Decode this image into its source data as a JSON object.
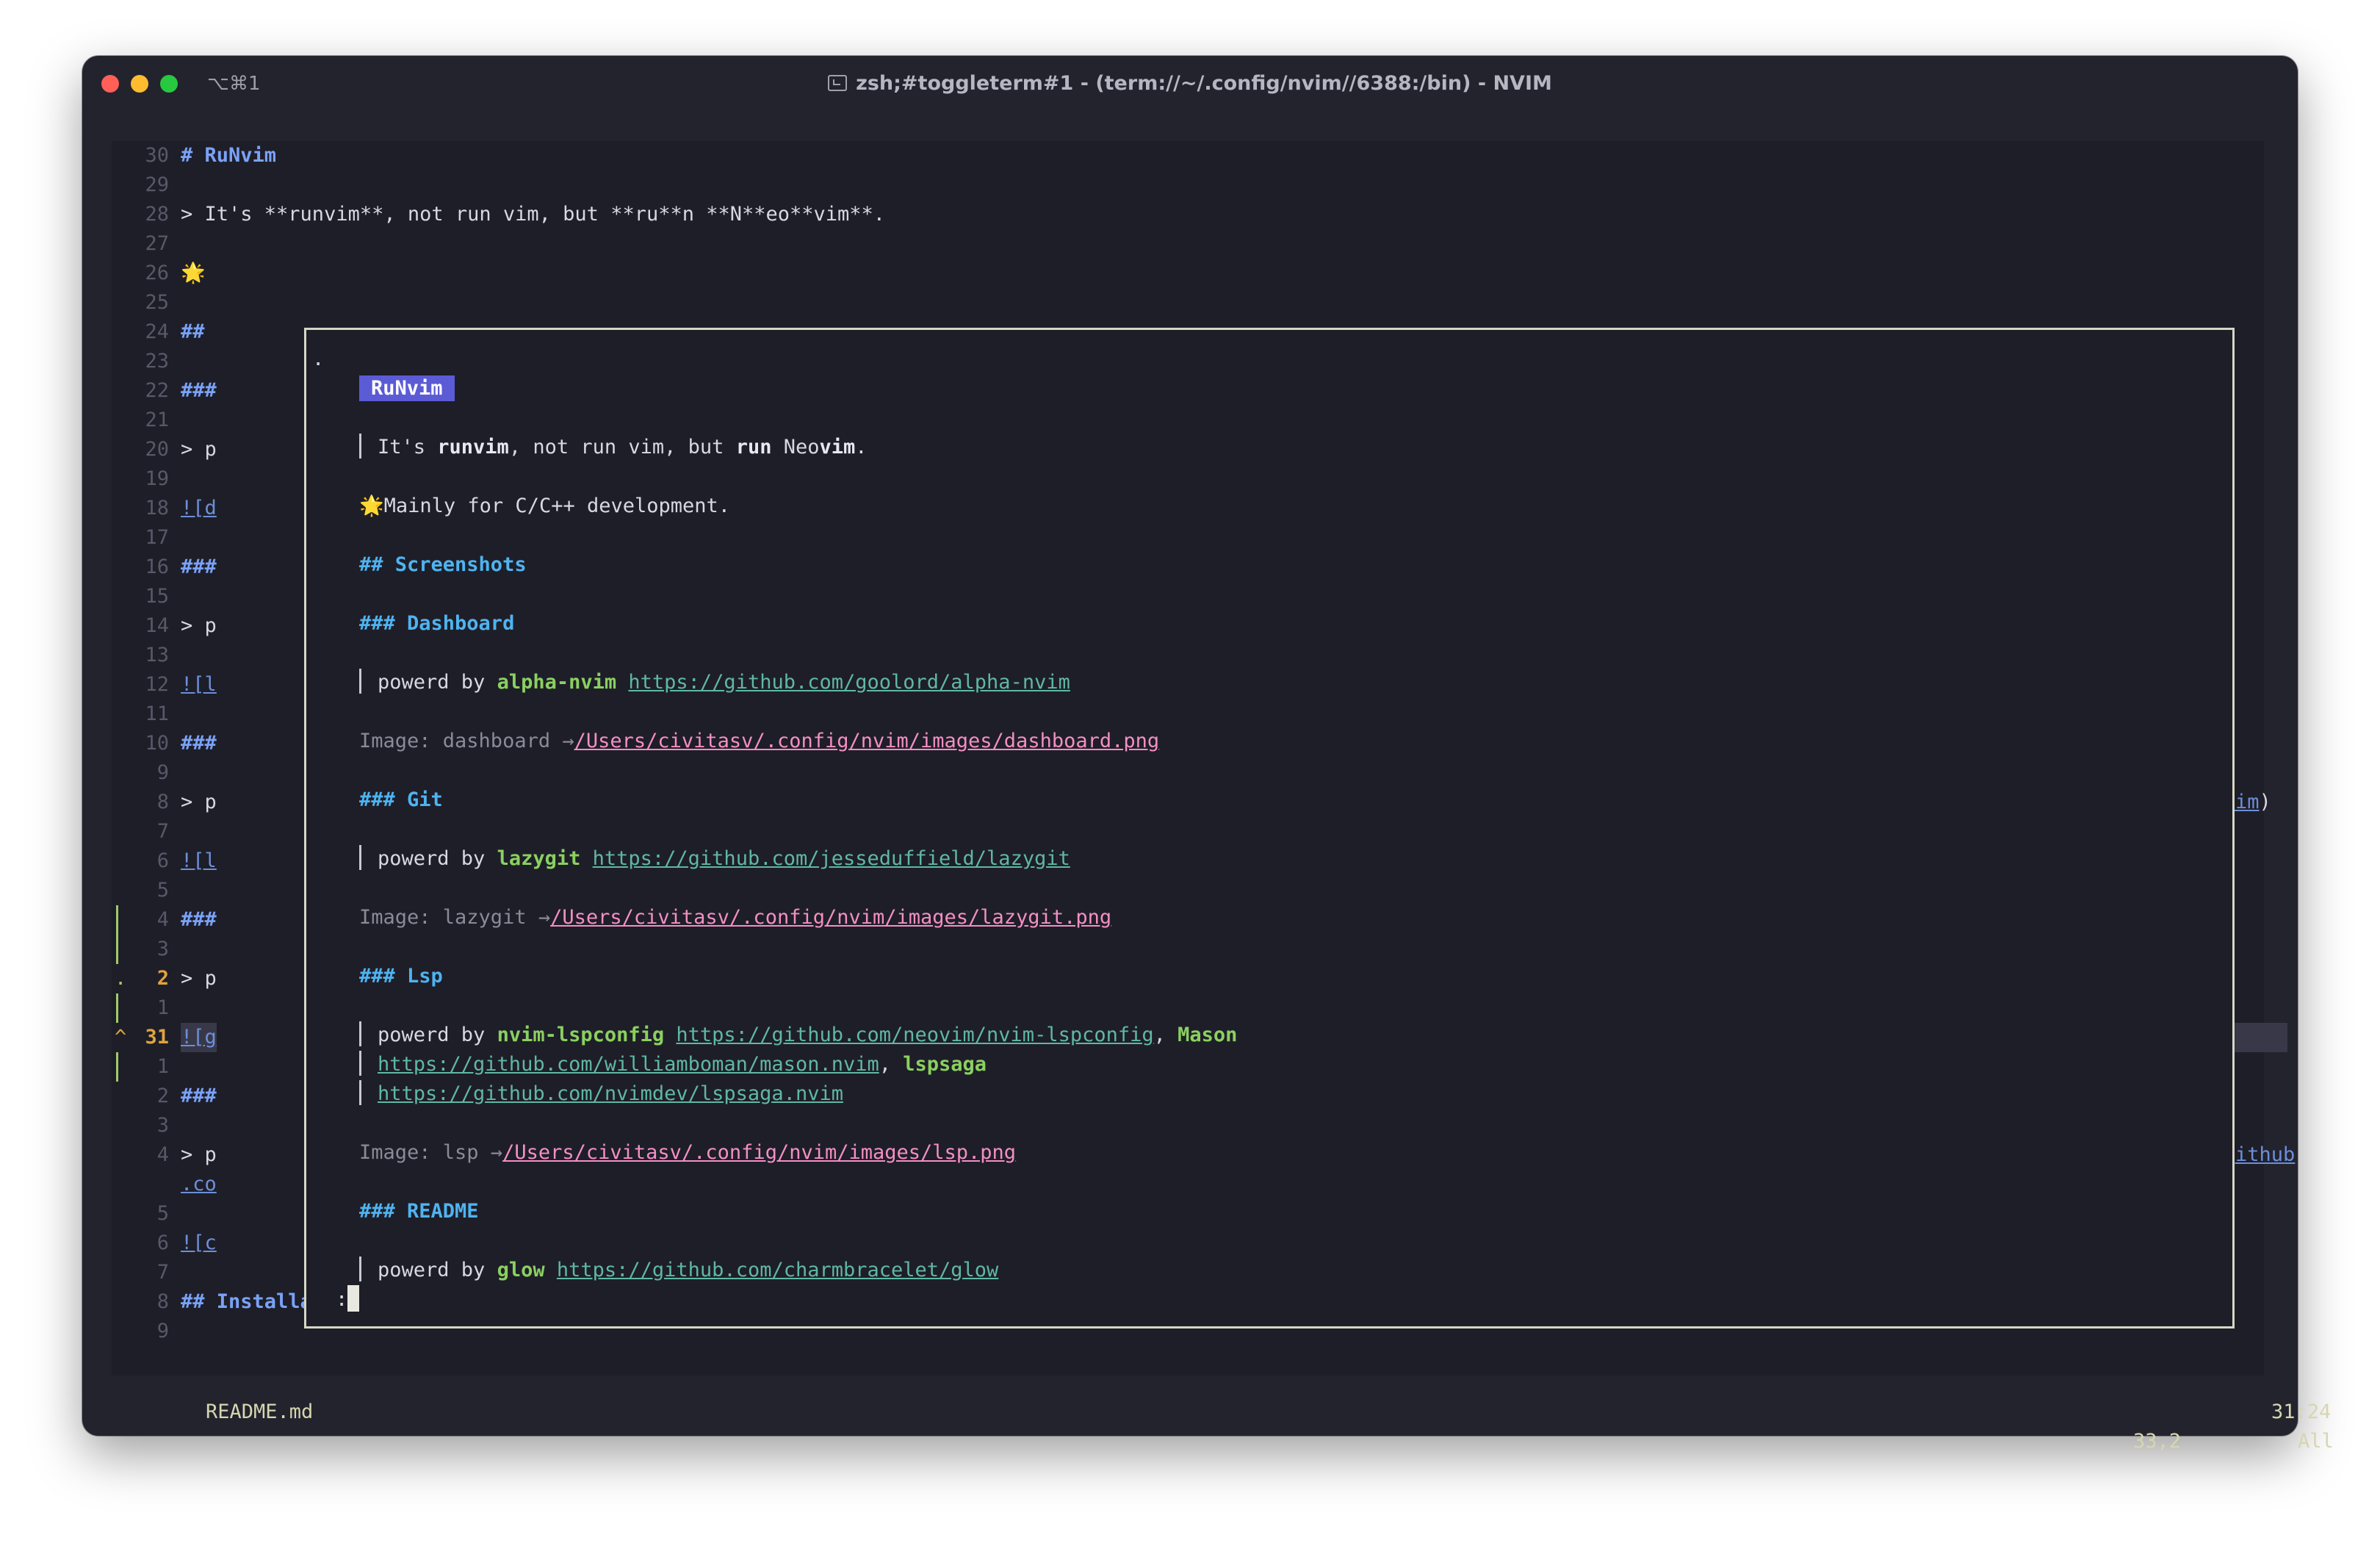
{
  "window": {
    "shortcut": "⌥⌘1",
    "title": "zsh;#toggleterm#1 - (term://~/.config/nvim//6388:/bin) - NVIM"
  },
  "editor": {
    "lines": [
      {
        "n": "30",
        "text": "# RuNvim"
      },
      {
        "n": "29",
        "text": ""
      },
      {
        "n": "28",
        "text": "> It's **runvim**, not run vim, but **ru**n **N**eo**vim**."
      },
      {
        "n": "27",
        "text": ""
      },
      {
        "n": "26",
        "text": "🌟"
      },
      {
        "n": "25",
        "text": ""
      },
      {
        "n": "24",
        "text": "##"
      },
      {
        "n": "23",
        "text": ""
      },
      {
        "n": "22",
        "text": "###"
      },
      {
        "n": "21",
        "text": ""
      },
      {
        "n": "20",
        "text": "> p"
      },
      {
        "n": "19",
        "text": ""
      },
      {
        "n": "18",
        "text": "![d"
      },
      {
        "n": "17",
        "text": ""
      },
      {
        "n": "16",
        "text": "###"
      },
      {
        "n": "15",
        "text": ""
      },
      {
        "n": "14",
        "text": "> p"
      },
      {
        "n": "13",
        "text": ""
      },
      {
        "n": "12",
        "text": "![l"
      },
      {
        "n": "11",
        "text": ""
      },
      {
        "n": "10",
        "text": "###"
      },
      {
        "n": "9",
        "text": ""
      },
      {
        "n": "8",
        "text": "> p"
      },
      {
        "n": "7",
        "text": ""
      },
      {
        "n": "6",
        "text": "![l"
      },
      {
        "n": "5",
        "text": ""
      },
      {
        "n": "4",
        "text": "###"
      },
      {
        "n": "3",
        "text": ""
      },
      {
        "n": "2",
        "text": "> p"
      },
      {
        "n": "1",
        "text": ""
      },
      {
        "n": "31",
        "text": "![g"
      },
      {
        "n": "1",
        "text": ""
      },
      {
        "n": "2",
        "text": "###"
      },
      {
        "n": "3",
        "text": ""
      },
      {
        "n": "4",
        "text": "> p"
      },
      {
        "n": "",
        "text": ".co"
      },
      {
        "n": "5",
        "text": ""
      },
      {
        "n": "6",
        "text": "![c"
      },
      {
        "n": "7",
        "text": ""
      },
      {
        "n": "8",
        "text": "## Installation"
      },
      {
        "n": "9",
        "text": ""
      }
    ],
    "right_fragments": {
      "line8": "a.nvim",
      "line8_paren": ")",
      "line4": "://github"
    },
    "current_line_sign": "^",
    "sign_dot": "."
  },
  "preview": {
    "dot": ".",
    "title_badge": "RuNvim",
    "quote1": {
      "a": "It's ",
      "b": "runvim",
      "c": ", not run vim, but ",
      "d": "run",
      "e": " Neo",
      "f": "vim",
      "g": "."
    },
    "star_line": "Mainly for C/C++ development.",
    "star_emoji": "🌟",
    "h_screenshots": "## Screenshots",
    "h_dashboard": "### Dashboard",
    "dash_powered": "powerd by ",
    "dash_plugin": "alpha-nvim",
    "dash_link": "https://github.com/goolord/alpha-nvim",
    "dash_img_label": "Image: dashboard →",
    "dash_img_path": "/Users/civitasv/.config/nvim/images/dashboard.png",
    "h_git": "### Git",
    "git_powered": "powerd by ",
    "git_plugin": "lazygit",
    "git_link": "https://github.com/jesseduffield/lazygit",
    "git_img_label": "Image: lazygit →",
    "git_img_path": "/Users/civitasv/.config/nvim/images/lazygit.png",
    "h_lsp": "### Lsp",
    "lsp_powered": "powerd by ",
    "lsp_plugin": "nvim-lspconfig",
    "lsp_link1": "https://github.com/neovim/nvim-lspconfig",
    "lsp_sep": ", ",
    "lsp_plugin2": "Mason",
    "lsp_link2": "https://github.com/williamboman/mason.nvim",
    "lsp_sep2": ", ",
    "lsp_plugin3": "lspsaga",
    "lsp_link3": "https://github.com/nvimdev/lspsaga.nvim",
    "lsp_img_label": "Image: lsp →",
    "lsp_img_path": "/Users/civitasv/.config/nvim/images/lsp.png",
    "h_readme": "### README",
    "readme_powered": "powerd by ",
    "readme_plugin": "glow",
    "readme_link": "https://github.com/charmbracelet/glow",
    "prompt": ":"
  },
  "status": {
    "file": "README.md",
    "position": "31:24",
    "ruler_pos": "33,2",
    "ruler_all": "All"
  }
}
